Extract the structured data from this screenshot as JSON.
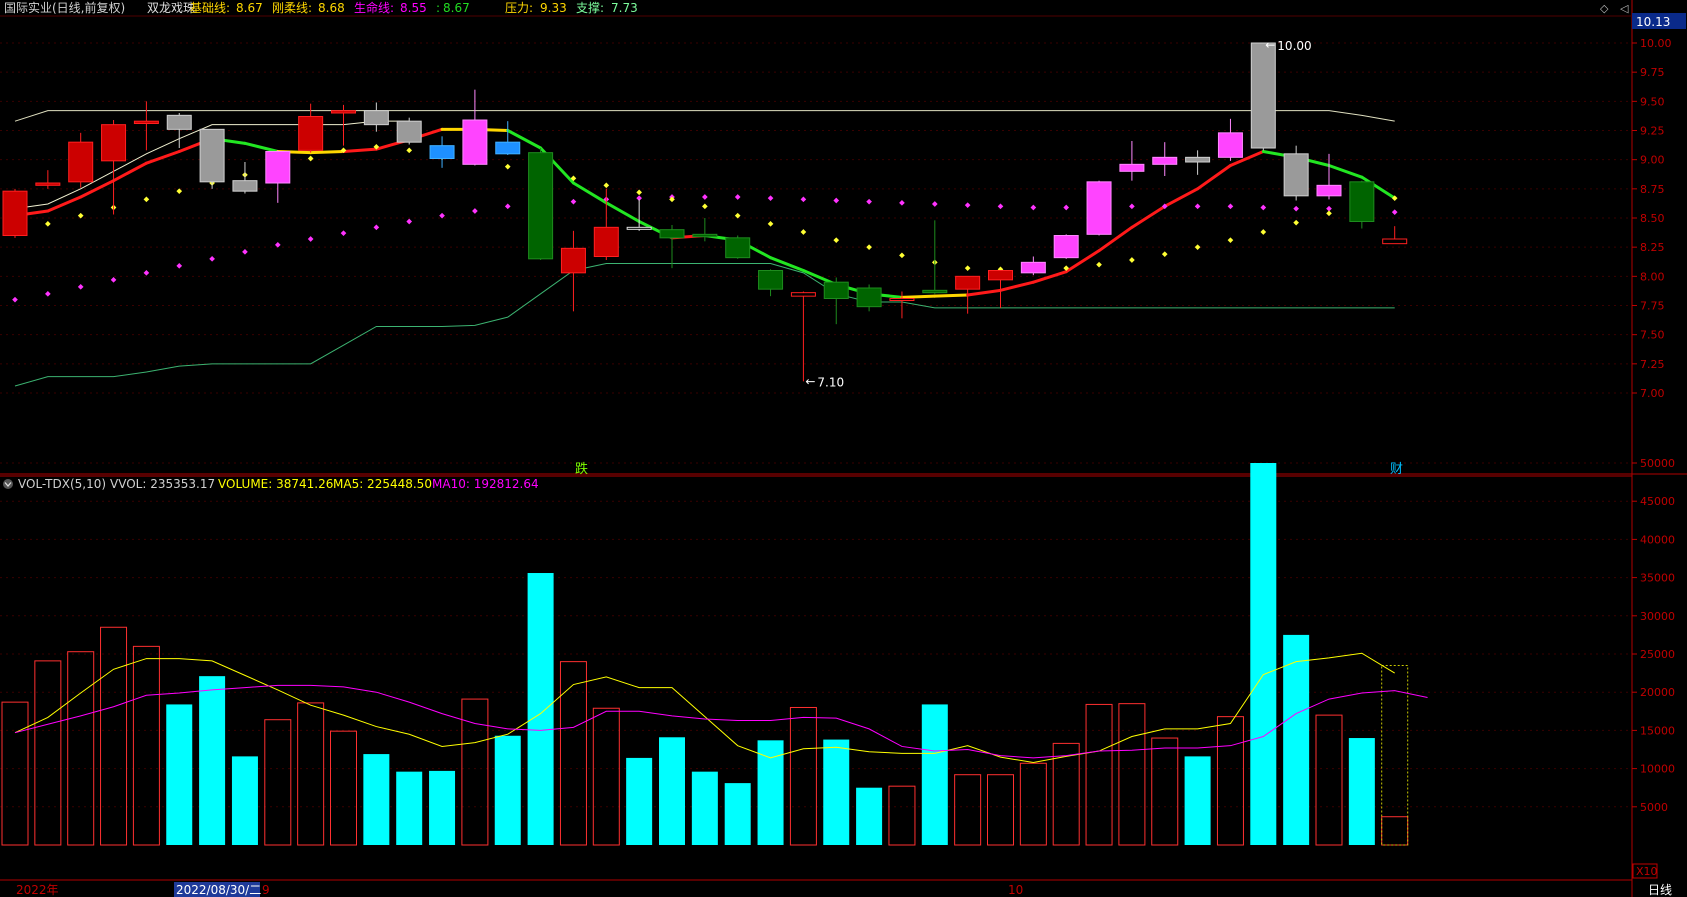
{
  "header": {
    "stock": "国际实业(日线,前复权)",
    "indicator": "双龙戏珠",
    "items": [
      {
        "label": "基础线:",
        "value": "8.67",
        "color": "#ffd700"
      },
      {
        "label": "刚柔线:",
        "value": "8.68",
        "color": "#ffd700"
      },
      {
        "label": "生命线:",
        "value": "8.55",
        "color": "#ff00ff"
      },
      {
        "label": ":",
        "value": "8.67",
        "color": "#22dd22"
      },
      {
        "label": "压力:",
        "value": "9.33",
        "color": "#ffd700"
      },
      {
        "label": "支撑:",
        "value": "7.73",
        "color": "#7cfc9c"
      }
    ],
    "price_box": "10.13"
  },
  "vol_header": {
    "name": "VOL-TDX(5,10)",
    "vvol": "VVOL: 235353.17",
    "volume": "VOLUME: 38741.26",
    "ma5": "MA5: 225448.50",
    "ma10": "MA10: 192812.64"
  },
  "markers": {
    "high": "10.00",
    "low": "7.10",
    "die": "跌",
    "cai": "财"
  },
  "x_axis": {
    "year": "2022年",
    "cursor": "2022/08/30/二",
    "nine": "9",
    "ten": "10",
    "period": "日线",
    "vol_scale": "X10"
  },
  "colors": {
    "up": "#ff2020",
    "down": "#00ffff",
    "grid": "#7a0000",
    "axis": "#c00000",
    "support": "#3cb371",
    "pressure": "#e0e0c0"
  },
  "chart_data": [
    {
      "type": "candlestick",
      "title": "国际实业(日线,前复权)",
      "y_ticks": [
        7.0,
        7.25,
        7.5,
        7.75,
        8.0,
        8.25,
        8.5,
        8.75,
        9.0,
        9.25,
        9.5,
        9.75,
        10.0
      ],
      "ylim": [
        6.85,
        10.1
      ],
      "candles": [
        {
          "o": 8.35,
          "h": 8.75,
          "l": 8.33,
          "c": 8.73,
          "color": "red"
        },
        {
          "o": 8.78,
          "h": 8.91,
          "l": 8.75,
          "c": 8.8,
          "color": "red"
        },
        {
          "o": 8.81,
          "h": 9.23,
          "l": 8.76,
          "c": 9.15,
          "color": "red"
        },
        {
          "o": 8.99,
          "h": 9.34,
          "l": 8.53,
          "c": 9.3,
          "color": "red"
        },
        {
          "o": 9.31,
          "h": 9.5,
          "l": 9.08,
          "c": 9.33,
          "color": "red"
        },
        {
          "o": 9.38,
          "h": 9.4,
          "l": 9.1,
          "c": 9.26,
          "color": "gray"
        },
        {
          "o": 9.26,
          "h": 9.26,
          "l": 8.75,
          "c": 8.81,
          "color": "gray"
        },
        {
          "o": 8.82,
          "h": 8.98,
          "l": 8.71,
          "c": 8.73,
          "color": "gray"
        },
        {
          "o": 8.8,
          "h": 9.08,
          "l": 8.63,
          "c": 9.07,
          "color": "magenta"
        },
        {
          "o": 9.08,
          "h": 9.48,
          "l": 9.06,
          "c": 9.37,
          "color": "red"
        },
        {
          "o": 9.4,
          "h": 9.47,
          "l": 9.12,
          "c": 9.42,
          "color": "red"
        },
        {
          "o": 9.42,
          "h": 9.49,
          "l": 9.24,
          "c": 9.3,
          "color": "gray"
        },
        {
          "o": 9.33,
          "h": 9.36,
          "l": 9.13,
          "c": 9.15,
          "color": "gray"
        },
        {
          "o": 9.12,
          "h": 9.2,
          "l": 8.93,
          "c": 9.01,
          "color": "blue"
        },
        {
          "o": 8.96,
          "h": 9.6,
          "l": 8.95,
          "c": 9.34,
          "color": "magenta"
        },
        {
          "o": 9.15,
          "h": 9.33,
          "l": 9.04,
          "c": 9.05,
          "color": "blue"
        },
        {
          "o": 9.06,
          "h": 9.1,
          "l": 8.14,
          "c": 8.15,
          "color": "green"
        },
        {
          "o": 8.03,
          "h": 8.39,
          "l": 7.7,
          "c": 8.24,
          "color": "red"
        },
        {
          "o": 8.17,
          "h": 8.75,
          "l": 8.14,
          "c": 8.42,
          "color": "red"
        },
        {
          "o": 8.42,
          "h": 8.66,
          "l": 8.39,
          "c": 8.42,
          "color": "white"
        },
        {
          "o": 8.4,
          "h": 8.44,
          "l": 8.07,
          "c": 8.33,
          "color": "green"
        },
        {
          "o": 8.36,
          "h": 8.5,
          "l": 8.3,
          "c": 8.34,
          "color": "green"
        },
        {
          "o": 8.33,
          "h": 8.35,
          "l": 8.15,
          "c": 8.16,
          "color": "green"
        },
        {
          "o": 8.05,
          "h": 8.06,
          "l": 7.83,
          "c": 7.89,
          "color": "green"
        },
        {
          "o": 7.86,
          "h": 7.87,
          "l": 7.1,
          "c": 7.83,
          "color": "red"
        },
        {
          "o": 7.95,
          "h": 7.99,
          "l": 7.59,
          "c": 7.81,
          "color": "green"
        },
        {
          "o": 7.9,
          "h": 7.93,
          "l": 7.7,
          "c": 7.74,
          "color": "green"
        },
        {
          "o": 7.81,
          "h": 7.87,
          "l": 7.64,
          "c": 7.8,
          "color": "red"
        },
        {
          "o": 7.88,
          "h": 8.48,
          "l": 7.85,
          "c": 7.86,
          "color": "green"
        },
        {
          "o": 7.89,
          "h": 8.0,
          "l": 7.68,
          "c": 8.0,
          "color": "red"
        },
        {
          "o": 7.97,
          "h": 8.04,
          "l": 7.73,
          "c": 8.05,
          "color": "red"
        },
        {
          "o": 8.03,
          "h": 8.17,
          "l": 8.01,
          "c": 8.12,
          "color": "magenta"
        },
        {
          "o": 8.16,
          "h": 8.36,
          "l": 8.15,
          "c": 8.35,
          "color": "magenta"
        },
        {
          "o": 8.36,
          "h": 8.82,
          "l": 8.35,
          "c": 8.81,
          "color": "magenta"
        },
        {
          "o": 8.9,
          "h": 9.16,
          "l": 8.82,
          "c": 8.96,
          "color": "magenta"
        },
        {
          "o": 8.96,
          "h": 9.15,
          "l": 8.86,
          "c": 9.02,
          "color": "magenta"
        },
        {
          "o": 8.98,
          "h": 9.08,
          "l": 8.87,
          "c": 9.02,
          "color": "gray"
        },
        {
          "o": 9.02,
          "h": 9.35,
          "l": 8.99,
          "c": 9.23,
          "color": "magenta"
        },
        {
          "o": 9.1,
          "h": 10.0,
          "l": 9.08,
          "c": 10.0,
          "color": "gray"
        },
        {
          "o": 9.05,
          "h": 9.12,
          "l": 8.65,
          "c": 8.69,
          "color": "gray"
        },
        {
          "o": 8.69,
          "h": 9.05,
          "l": 8.66,
          "c": 8.78,
          "color": "magenta"
        },
        {
          "o": 8.81,
          "h": 8.82,
          "l": 8.41,
          "c": 8.47,
          "color": "green"
        },
        {
          "o": 8.28,
          "h": 8.43,
          "l": 8.28,
          "c": 8.32,
          "color": "red_hollow"
        }
      ],
      "base_line": [
        8.52,
        8.56,
        8.68,
        8.82,
        8.97,
        9.07,
        9.18,
        9.14,
        9.07,
        9.06,
        9.07,
        9.09,
        9.17,
        9.26,
        9.26,
        9.25,
        9.1,
        8.8,
        8.63,
        8.47,
        8.33,
        8.35,
        8.31,
        8.16,
        8.05,
        7.93,
        7.85,
        7.82,
        7.83,
        7.84,
        7.88,
        7.95,
        8.04,
        8.22,
        8.42,
        8.6,
        8.75,
        8.95,
        9.07,
        9.02,
        8.95,
        8.85,
        8.67
      ],
      "gentle_line": [
        8.58,
        8.62,
        8.75,
        8.9,
        9.05,
        9.18,
        9.3,
        9.3,
        9.3,
        9.3,
        9.3,
        9.33,
        9.33
      ],
      "life_dots": [
        7.8,
        7.85,
        7.91,
        7.97,
        8.03,
        8.09,
        8.15,
        8.21,
        8.27,
        8.32,
        8.37,
        8.42,
        8.47,
        8.52,
        8.56,
        8.6,
        8.63,
        8.64,
        8.66,
        8.67,
        8.68,
        8.68,
        8.68,
        8.67,
        8.66,
        8.65,
        8.64,
        8.63,
        8.62,
        8.61,
        8.6,
        8.59,
        8.59,
        8.6,
        8.6,
        8.6,
        8.6,
        8.6,
        8.59,
        8.58,
        8.58,
        8.57,
        8.55
      ],
      "yellow_dots": [
        8.38,
        8.45,
        8.52,
        8.59,
        8.66,
        8.73,
        8.8,
        8.87,
        8.94,
        9.01,
        9.08,
        9.11,
        9.08,
        9.02,
        8.98,
        8.94,
        8.9,
        8.84,
        8.78,
        8.72,
        8.66,
        8.6,
        8.52,
        8.45,
        8.38,
        8.31,
        8.25,
        8.18,
        8.12,
        8.07,
        8.06,
        8.05,
        8.07,
        8.1,
        8.14,
        8.19,
        8.25,
        8.31,
        8.38,
        8.46,
        8.54,
        8.62,
        8.67
      ],
      "pressure": [
        9.33,
        9.42,
        9.42,
        9.42,
        9.42,
        9.42,
        9.42,
        9.42,
        9.42,
        9.42,
        9.42,
        9.42,
        9.42,
        9.42,
        9.42,
        9.42,
        9.42,
        9.42,
        9.42,
        9.42,
        9.42,
        9.42,
        9.42,
        9.42,
        9.42,
        9.42,
        9.42,
        9.42,
        9.42,
        9.42,
        9.42,
        9.42,
        9.42,
        9.42,
        9.42,
        9.42,
        9.42,
        9.42,
        9.42,
        9.42,
        9.42,
        9.38,
        9.33
      ],
      "support": [
        7.06,
        7.14,
        7.14,
        7.14,
        7.18,
        7.23,
        7.25,
        7.25,
        7.25,
        7.25,
        7.41,
        7.57,
        7.57,
        7.57,
        7.58,
        7.65,
        7.85,
        8.05,
        8.11,
        8.11,
        8.11,
        8.11,
        8.11,
        8.11,
        8.03,
        7.85,
        7.78,
        7.78,
        7.73,
        7.73,
        7.73,
        7.73,
        7.73,
        7.73,
        7.73,
        7.73,
        7.73,
        7.73,
        7.73,
        7.73,
        7.73,
        7.73,
        7.73
      ]
    },
    {
      "type": "bar",
      "title": "VOL-TDX(5,10)",
      "y_ticks": [
        5000,
        10000,
        15000,
        20000,
        25000,
        30000,
        35000,
        40000,
        45000,
        50000
      ],
      "ylim": [
        0,
        50000
      ],
      "volumes": [
        18700,
        24100,
        25300,
        28500,
        26000,
        18400,
        22100,
        11600,
        16400,
        18600,
        14900,
        11900,
        9600,
        9700,
        19100,
        14300,
        35600,
        24000,
        17900,
        11400,
        14100,
        9600,
        8100,
        13700,
        18000,
        13800,
        7500,
        7700,
        18400,
        9200,
        9200,
        10700,
        13300,
        18400,
        18500,
        14000,
        11600,
        16800,
        50000,
        27500,
        17000,
        14000,
        3700
      ],
      "bar_colors": [
        "red",
        "red",
        "red",
        "red",
        "red",
        "cyan",
        "cyan",
        "cyan",
        "red",
        "red",
        "red",
        "cyan",
        "cyan",
        "cyan",
        "red",
        "cyan",
        "cyan",
        "red",
        "red",
        "cyan",
        "cyan",
        "cyan",
        "cyan",
        "cyan",
        "red",
        "cyan",
        "cyan",
        "red",
        "cyan",
        "red",
        "red",
        "red",
        "red",
        "red",
        "red",
        "red",
        "cyan",
        "red",
        "cyan",
        "cyan",
        "red",
        "cyan",
        "red"
      ],
      "ma5": [
        14700,
        16700,
        19900,
        23000,
        24400,
        24400,
        24100,
        22200,
        20300,
        18300,
        17000,
        15500,
        14500,
        12900,
        13400,
        14500,
        17200,
        21000,
        22000,
        20600,
        20600,
        16800,
        13000,
        11400,
        12600,
        12800,
        12200,
        12000,
        12000,
        13000,
        11500,
        10800,
        11600,
        12300,
        14200,
        15200,
        15200,
        15900,
        22300,
        24000,
        24500,
        25100,
        22500
      ],
      "ma10": [
        14700,
        15800,
        16900,
        18100,
        19600,
        19900,
        20300,
        20600,
        20900,
        20900,
        20700,
        20000,
        18700,
        17200,
        15900,
        15200,
        15000,
        15400,
        17500,
        17500,
        16900,
        16500,
        16300,
        16300,
        16700,
        16600,
        15200,
        12900,
        12300,
        12500,
        11700,
        11400,
        11700,
        12300,
        12400,
        12700,
        12700,
        13000,
        14200,
        17200,
        19100,
        19900,
        20200,
        19300
      ]
    }
  ]
}
